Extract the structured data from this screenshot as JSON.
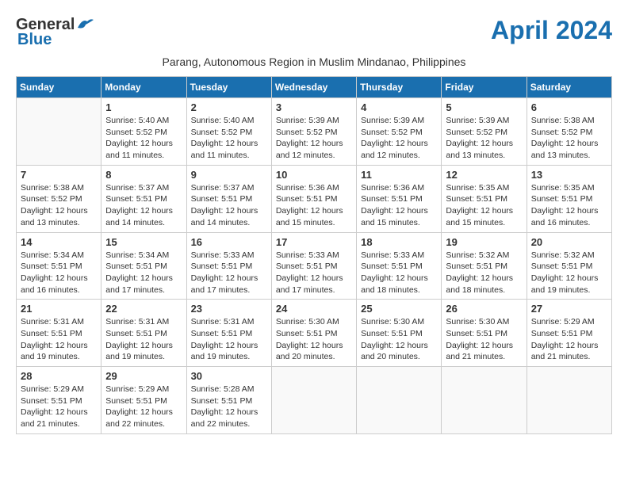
{
  "header": {
    "logo_general": "General",
    "logo_blue": "Blue",
    "month_title": "April 2024",
    "subtitle": "Parang, Autonomous Region in Muslim Mindanao, Philippines"
  },
  "columns": [
    "Sunday",
    "Monday",
    "Tuesday",
    "Wednesday",
    "Thursday",
    "Friday",
    "Saturday"
  ],
  "weeks": [
    [
      {
        "day": "",
        "info": ""
      },
      {
        "day": "1",
        "info": "Sunrise: 5:40 AM\nSunset: 5:52 PM\nDaylight: 12 hours\nand 11 minutes."
      },
      {
        "day": "2",
        "info": "Sunrise: 5:40 AM\nSunset: 5:52 PM\nDaylight: 12 hours\nand 11 minutes."
      },
      {
        "day": "3",
        "info": "Sunrise: 5:39 AM\nSunset: 5:52 PM\nDaylight: 12 hours\nand 12 minutes."
      },
      {
        "day": "4",
        "info": "Sunrise: 5:39 AM\nSunset: 5:52 PM\nDaylight: 12 hours\nand 12 minutes."
      },
      {
        "day": "5",
        "info": "Sunrise: 5:39 AM\nSunset: 5:52 PM\nDaylight: 12 hours\nand 13 minutes."
      },
      {
        "day": "6",
        "info": "Sunrise: 5:38 AM\nSunset: 5:52 PM\nDaylight: 12 hours\nand 13 minutes."
      }
    ],
    [
      {
        "day": "7",
        "info": "Sunrise: 5:38 AM\nSunset: 5:52 PM\nDaylight: 12 hours\nand 13 minutes."
      },
      {
        "day": "8",
        "info": "Sunrise: 5:37 AM\nSunset: 5:51 PM\nDaylight: 12 hours\nand 14 minutes."
      },
      {
        "day": "9",
        "info": "Sunrise: 5:37 AM\nSunset: 5:51 PM\nDaylight: 12 hours\nand 14 minutes."
      },
      {
        "day": "10",
        "info": "Sunrise: 5:36 AM\nSunset: 5:51 PM\nDaylight: 12 hours\nand 15 minutes."
      },
      {
        "day": "11",
        "info": "Sunrise: 5:36 AM\nSunset: 5:51 PM\nDaylight: 12 hours\nand 15 minutes."
      },
      {
        "day": "12",
        "info": "Sunrise: 5:35 AM\nSunset: 5:51 PM\nDaylight: 12 hours\nand 15 minutes."
      },
      {
        "day": "13",
        "info": "Sunrise: 5:35 AM\nSunset: 5:51 PM\nDaylight: 12 hours\nand 16 minutes."
      }
    ],
    [
      {
        "day": "14",
        "info": "Sunrise: 5:34 AM\nSunset: 5:51 PM\nDaylight: 12 hours\nand 16 minutes."
      },
      {
        "day": "15",
        "info": "Sunrise: 5:34 AM\nSunset: 5:51 PM\nDaylight: 12 hours\nand 17 minutes."
      },
      {
        "day": "16",
        "info": "Sunrise: 5:33 AM\nSunset: 5:51 PM\nDaylight: 12 hours\nand 17 minutes."
      },
      {
        "day": "17",
        "info": "Sunrise: 5:33 AM\nSunset: 5:51 PM\nDaylight: 12 hours\nand 17 minutes."
      },
      {
        "day": "18",
        "info": "Sunrise: 5:33 AM\nSunset: 5:51 PM\nDaylight: 12 hours\nand 18 minutes."
      },
      {
        "day": "19",
        "info": "Sunrise: 5:32 AM\nSunset: 5:51 PM\nDaylight: 12 hours\nand 18 minutes."
      },
      {
        "day": "20",
        "info": "Sunrise: 5:32 AM\nSunset: 5:51 PM\nDaylight: 12 hours\nand 19 minutes."
      }
    ],
    [
      {
        "day": "21",
        "info": "Sunrise: 5:31 AM\nSunset: 5:51 PM\nDaylight: 12 hours\nand 19 minutes."
      },
      {
        "day": "22",
        "info": "Sunrise: 5:31 AM\nSunset: 5:51 PM\nDaylight: 12 hours\nand 19 minutes."
      },
      {
        "day": "23",
        "info": "Sunrise: 5:31 AM\nSunset: 5:51 PM\nDaylight: 12 hours\nand 19 minutes."
      },
      {
        "day": "24",
        "info": "Sunrise: 5:30 AM\nSunset: 5:51 PM\nDaylight: 12 hours\nand 20 minutes."
      },
      {
        "day": "25",
        "info": "Sunrise: 5:30 AM\nSunset: 5:51 PM\nDaylight: 12 hours\nand 20 minutes."
      },
      {
        "day": "26",
        "info": "Sunrise: 5:30 AM\nSunset: 5:51 PM\nDaylight: 12 hours\nand 21 minutes."
      },
      {
        "day": "27",
        "info": "Sunrise: 5:29 AM\nSunset: 5:51 PM\nDaylight: 12 hours\nand 21 minutes."
      }
    ],
    [
      {
        "day": "28",
        "info": "Sunrise: 5:29 AM\nSunset: 5:51 PM\nDaylight: 12 hours\nand 21 minutes."
      },
      {
        "day": "29",
        "info": "Sunrise: 5:29 AM\nSunset: 5:51 PM\nDaylight: 12 hours\nand 22 minutes."
      },
      {
        "day": "30",
        "info": "Sunrise: 5:28 AM\nSunset: 5:51 PM\nDaylight: 12 hours\nand 22 minutes."
      },
      {
        "day": "",
        "info": ""
      },
      {
        "day": "",
        "info": ""
      },
      {
        "day": "",
        "info": ""
      },
      {
        "day": "",
        "info": ""
      }
    ]
  ]
}
